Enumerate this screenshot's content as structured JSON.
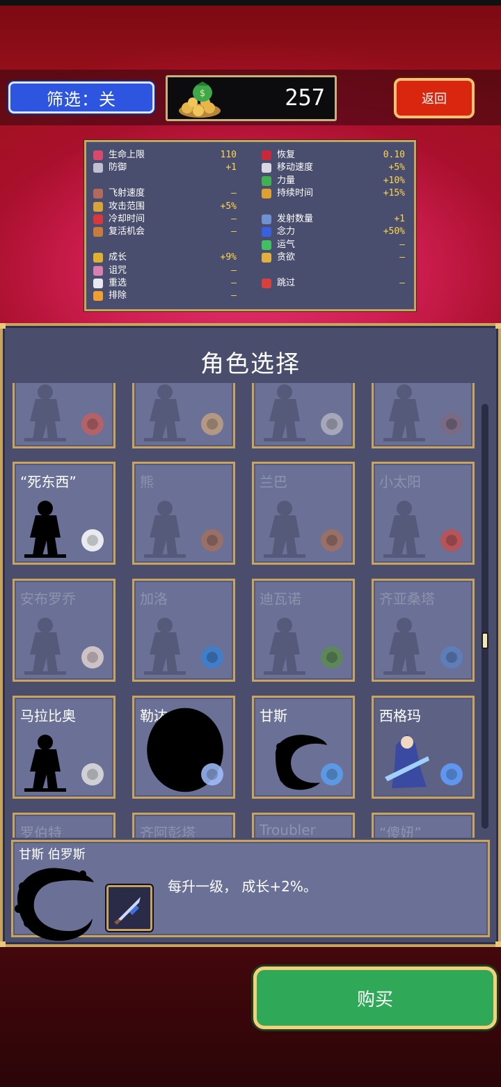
{
  "header": {
    "filter_label": "筛选：关",
    "coins": "257",
    "back_label": "返回"
  },
  "stats": [
    {
      "label": "生命上限",
      "value": "110",
      "icon_color": "#d94a6a",
      "col": 0,
      "row": 0,
      "icon": "heart-icon"
    },
    {
      "label": "防御",
      "value": "+1",
      "icon_color": "#c0c0d0",
      "col": 0,
      "row": 1,
      "icon": "armor-icon"
    },
    {
      "label": "飞射速度",
      "value": "–",
      "icon_color": "#b36a5a",
      "col": 0,
      "row": 3,
      "icon": "projectile-speed-icon"
    },
    {
      "label": "攻击范围",
      "value": "+5%",
      "icon_color": "#d9a23a",
      "col": 0,
      "row": 4,
      "icon": "area-icon"
    },
    {
      "label": "冷却时间",
      "value": "–",
      "icon_color": "#d9383a",
      "col": 0,
      "row": 5,
      "icon": "cooldown-icon"
    },
    {
      "label": "复活机会",
      "value": "–",
      "icon_color": "#c77b3e",
      "col": 0,
      "row": 6,
      "icon": "revival-icon"
    },
    {
      "label": "成长",
      "value": "+9%",
      "icon_color": "#e0b030",
      "col": 0,
      "row": 8,
      "icon": "growth-icon"
    },
    {
      "label": "诅咒",
      "value": "–",
      "icon_color": "#d880b0",
      "col": 0,
      "row": 9,
      "icon": "curse-icon"
    },
    {
      "label": "重选",
      "value": "–",
      "icon_color": "#e8e8f0",
      "col": 0,
      "row": 10,
      "icon": "reroll-icon"
    },
    {
      "label": "排除",
      "value": "–",
      "icon_color": "#f0a030",
      "col": 0,
      "row": 11,
      "icon": "banish-icon"
    },
    {
      "label": "恢复",
      "value": "0.10",
      "icon_color": "#c8283a",
      "col": 1,
      "row": 0,
      "icon": "recovery-icon"
    },
    {
      "label": "移动速度",
      "value": "+5%",
      "icon_color": "#d8d8e0",
      "col": 1,
      "row": 1,
      "icon": "wing-icon"
    },
    {
      "label": "力量",
      "value": "+10%",
      "icon_color": "#40b050",
      "col": 1,
      "row": 2,
      "icon": "might-icon"
    },
    {
      "label": "持续时间",
      "value": "+15%",
      "icon_color": "#e0a030",
      "col": 1,
      "row": 3,
      "icon": "duration-icon"
    },
    {
      "label": "发射数量",
      "value": "+1",
      "icon_color": "#7090d0",
      "col": 1,
      "row": 5,
      "icon": "amount-icon"
    },
    {
      "label": "念力",
      "value": "+50%",
      "icon_color": "#3a60e0",
      "col": 1,
      "row": 6,
      "icon": "magnet-icon"
    },
    {
      "label": "运气",
      "value": "–",
      "icon_color": "#40c060",
      "col": 1,
      "row": 7,
      "icon": "luck-icon"
    },
    {
      "label": "贪欲",
      "value": "–",
      "icon_color": "#e0b040",
      "col": 1,
      "row": 8,
      "icon": "greed-icon"
    },
    {
      "label": "跳过",
      "value": "–",
      "icon_color": "#d84040",
      "col": 1,
      "row": 10,
      "icon": "skip-icon"
    }
  ],
  "panel_title": "角色选择",
  "characters": [
    {
      "name": "",
      "state": "locked",
      "item": "axe-item-icon",
      "item_color": "#c06060"
    },
    {
      "name": "",
      "state": "locked",
      "item": "bone-pile-item-icon",
      "item_color": "#c0a080"
    },
    {
      "name": "",
      "state": "locked",
      "item": "scroll-item-icon",
      "item_color": "#b0b0c0"
    },
    {
      "name": "",
      "state": "locked",
      "item": "tree-item-icon",
      "item_color": "#7a6a80"
    },
    {
      "name": "“死东西”",
      "state": "unlocked-dark",
      "item": "bone-item-icon",
      "item_color": "#ffffff"
    },
    {
      "name": "熊",
      "state": "locked",
      "item": "shield-item-icon",
      "item_color": "#a07060"
    },
    {
      "name": "兰巴",
      "state": "locked",
      "item": "wheel-item-icon",
      "item_color": "#a07060"
    },
    {
      "name": "小太阳",
      "state": "locked",
      "item": "flower-item-icon",
      "item_color": "#c05050"
    },
    {
      "name": "安布罗乔",
      "state": "locked",
      "item": "egg-item-icon",
      "item_color": "#e0d0d0"
    },
    {
      "name": "加洛",
      "state": "locked",
      "item": "blue-weapon-item-icon",
      "item_color": "#3a80d0"
    },
    {
      "name": "迪瓦诺",
      "state": "locked",
      "item": "leaf-item-icon",
      "item_color": "#5a8a50"
    },
    {
      "name": "齐亚桑塔",
      "state": "locked",
      "item": "ring-item-icon",
      "item_color": "#5a80c0"
    },
    {
      "name": "马拉比奥",
      "state": "unlocked-dark",
      "item": "knives-item-icon",
      "item_color": "#e0e0e0"
    },
    {
      "name": "勒达",
      "state": "unlocked-dark",
      "item": "sparkle-item-icon",
      "item_color": "#a0c0ff"
    },
    {
      "name": "甘斯",
      "state": "unlocked-dark",
      "item": "dagger-item-icon",
      "item_color": "#5aa0f0"
    },
    {
      "name": "西格玛",
      "state": "unlocked",
      "item": "ice-star-item-icon",
      "item_color": "#60a0ff"
    },
    {
      "name": "罗伯特",
      "state": "locked",
      "item": "",
      "item_color": ""
    },
    {
      "name": "齐阿彭塔",
      "state": "locked",
      "item": "",
      "item_color": ""
    },
    {
      "name": "Troubler",
      "state": "locked",
      "item": "",
      "item_color": ""
    },
    {
      "name": "“傻妞”",
      "state": "locked",
      "item": "",
      "item_color": ""
    }
  ],
  "selected": {
    "name": "甘斯 伯罗斯",
    "description": "每升一级， 成长+2%。"
  },
  "buy_label": "购买"
}
